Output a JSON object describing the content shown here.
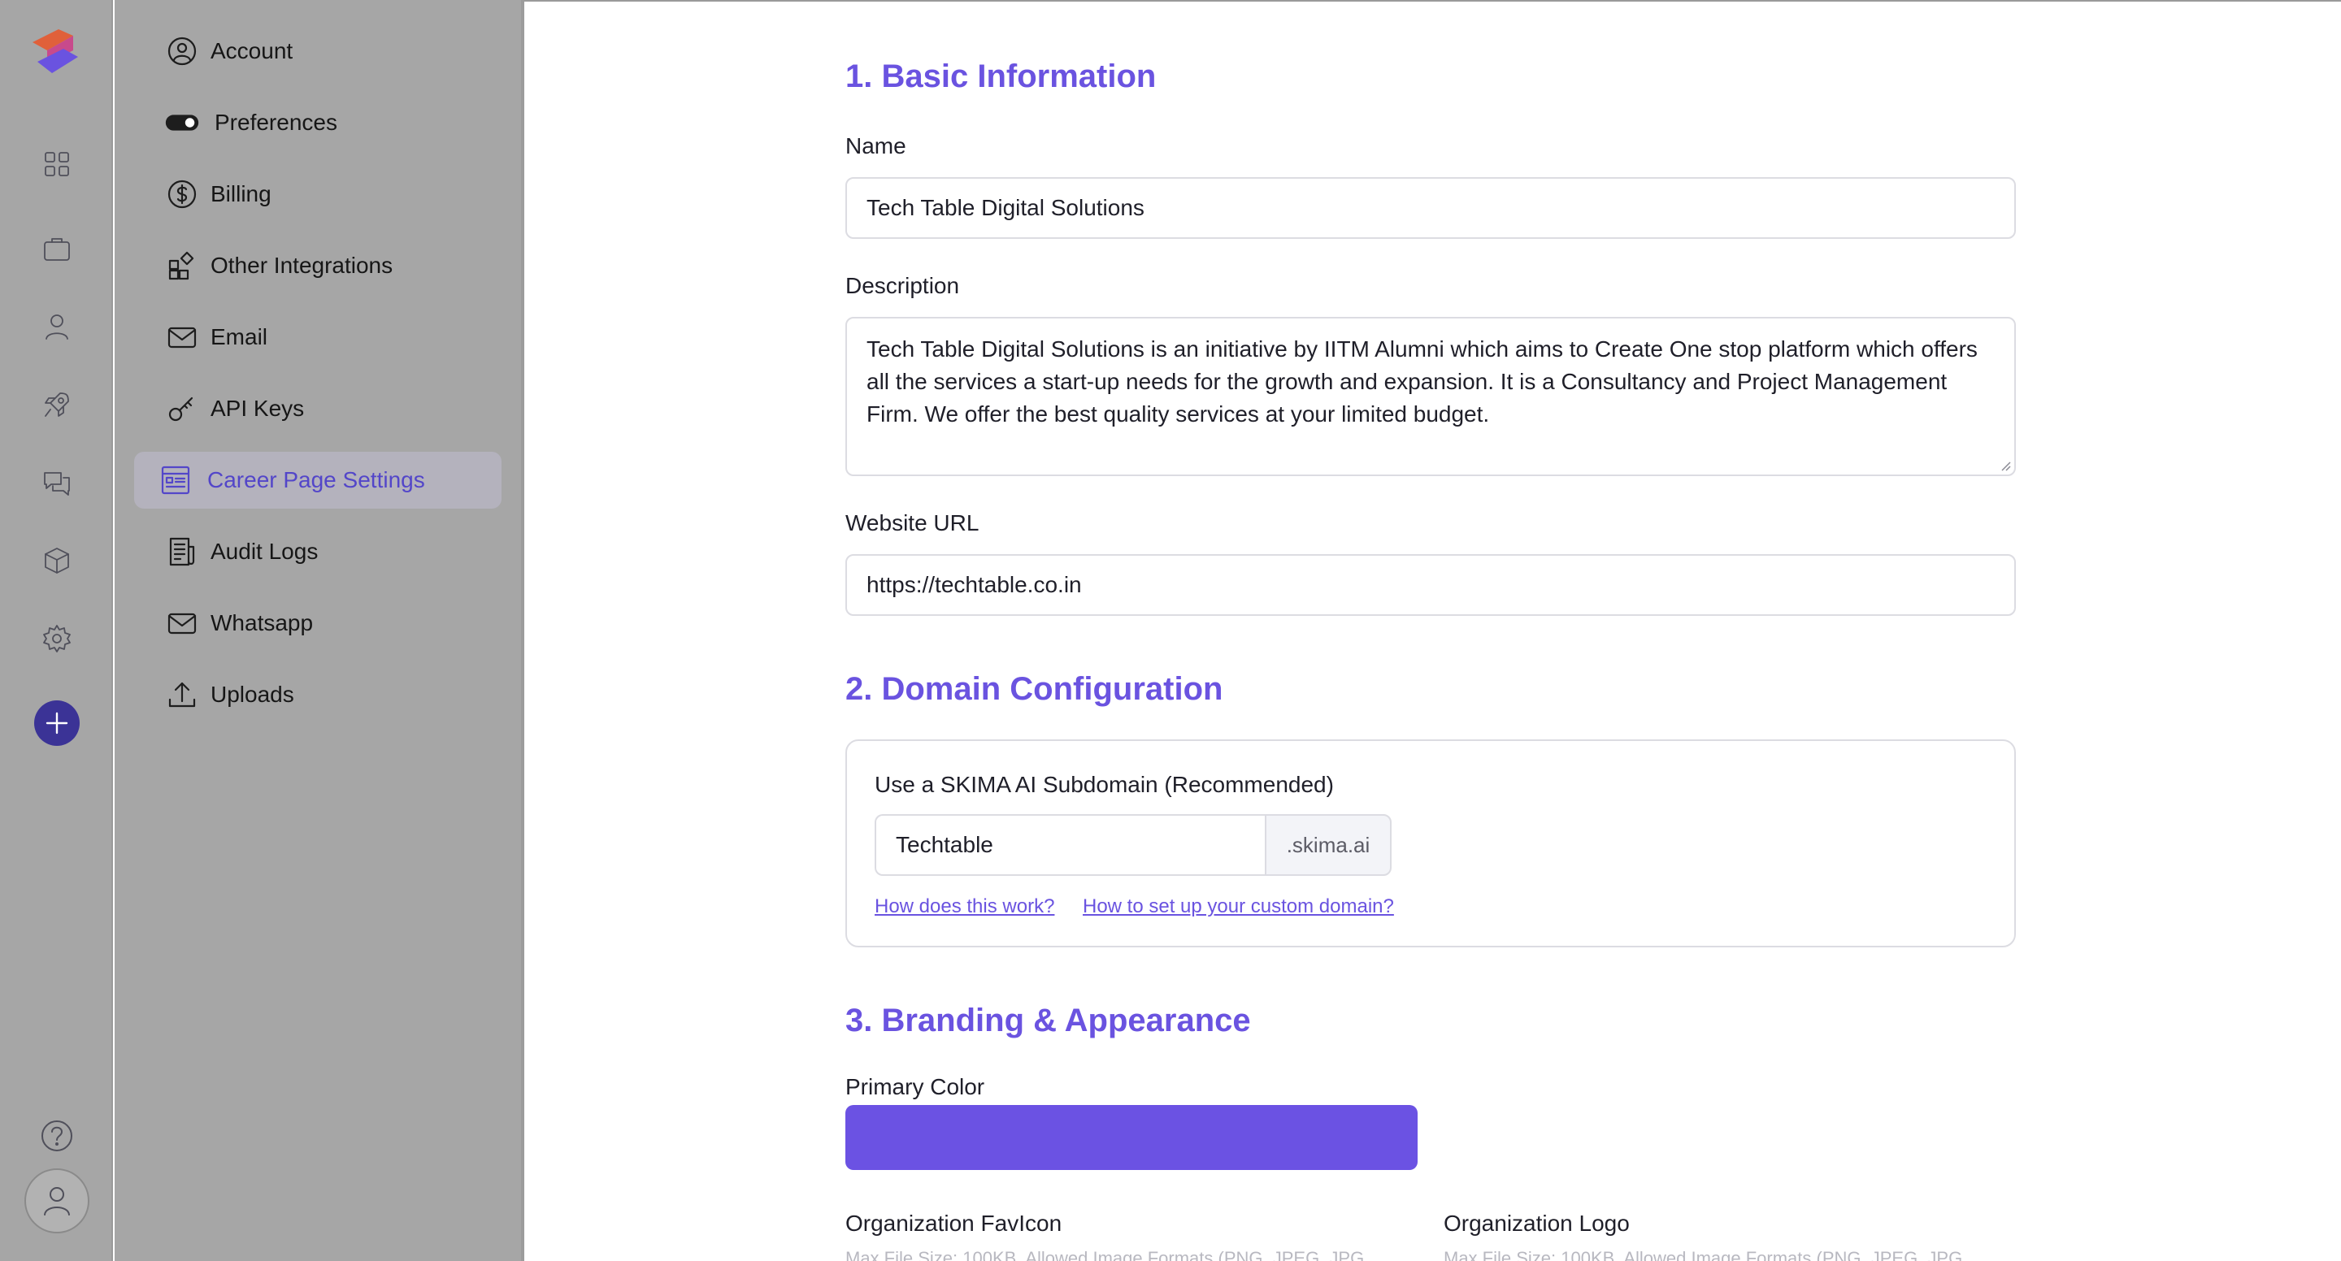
{
  "sidebar": {
    "items": [
      {
        "label": "Account",
        "icon": "user-circle-icon"
      },
      {
        "label": "Preferences",
        "icon": "toggle-icon"
      },
      {
        "label": "Billing",
        "icon": "dollar-circle-icon"
      },
      {
        "label": "Other Integrations",
        "icon": "integrations-icon"
      },
      {
        "label": "Email",
        "icon": "mail-icon"
      },
      {
        "label": "API Keys",
        "icon": "key-icon"
      },
      {
        "label": "Career Page Settings",
        "icon": "career-page-icon",
        "active": true
      },
      {
        "label": "Audit Logs",
        "icon": "document-icon"
      },
      {
        "label": "Whatsapp",
        "icon": "mail-icon"
      },
      {
        "label": "Uploads",
        "icon": "upload-icon"
      }
    ]
  },
  "main": {
    "basic": {
      "title": "1. Basic Information",
      "name_label": "Name",
      "name_value": "Tech Table Digital Solutions",
      "description_label": "Description",
      "description_value": "Tech Table Digital Solutions is an initiative by IITM Alumni which aims to Create One stop platform which offers all the services a start-up needs for the growth and expansion. It is a Consultancy and Project Management Firm. We offer the best quality services at your limited budget.",
      "website_label": "Website URL",
      "website_value": "https://techtable.co.in"
    },
    "domain": {
      "title": "2. Domain Configuration",
      "subdomain_label": "Use a SKIMA AI Subdomain (Recommended)",
      "subdomain_value": "Techtable",
      "suffix": ".skima.ai",
      "link_how": "How does this work?",
      "link_custom": "How to set up your custom domain?"
    },
    "branding": {
      "title": "3. Branding & Appearance",
      "primary_color_label": "Primary Color",
      "primary_color": "#6b52e3",
      "favicon_label": "Organization FavIcon",
      "favicon_hint": "Max File Size: 100KB. Allowed Image Formats (PNG, JPEG, JPG",
      "logo_label": "Organization Logo",
      "logo_hint": "Max File Size: 100KB. Allowed Image Formats (PNG, JPEG, JPG"
    }
  },
  "colors": {
    "accent": "#6a53e0",
    "rail_plus": "#3b3396"
  }
}
